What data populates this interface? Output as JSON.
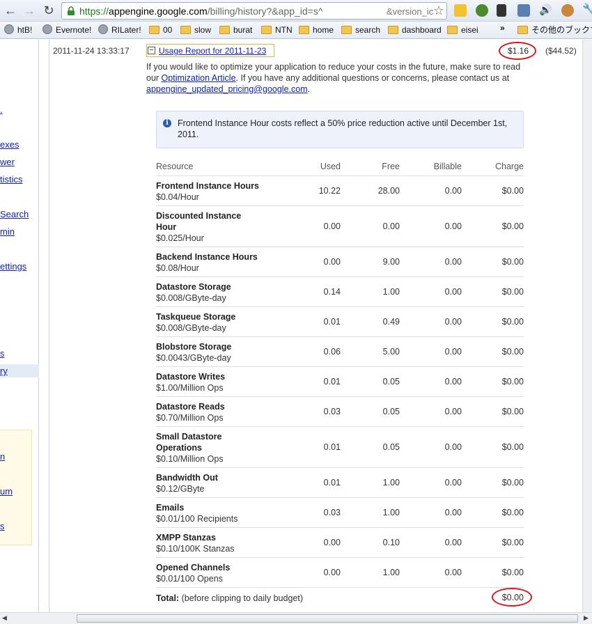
{
  "browser": {
    "url_scheme": "https://",
    "url_host": "appengine.google.com",
    "url_path": "/billing/history?&app_id=s^",
    "url_tail": "&version_ic",
    "bookmarks": [
      "htB!",
      "Evernote!",
      "RILater!",
      "00",
      "slow",
      "burat",
      "NTN",
      "home",
      "search",
      "dashboard",
      "eisei",
      "»",
      "その他のブックマーク"
    ]
  },
  "leftnav": {
    "items": [
      ".",
      "exes",
      "wer",
      "tistics",
      "Search",
      "min",
      "ettings",
      "s",
      "ry",
      "n",
      "um",
      "s"
    ]
  },
  "entry": {
    "datetime": "2011-11-24 13:33:17",
    "collapse_glyph": "−",
    "report_link": "Usage Report for 2011-11-23",
    "amount": "$1.16",
    "balance": "($44.52)",
    "advice_1": "If you would like to optimize your application to reduce your costs in the future, make sure to read our ",
    "advice_link_1": "Optimization Article",
    "advice_2": ". If you have any additional questions or concerns, please contact us at ",
    "advice_link_2": "appengine_updated_pricing@google.com",
    "advice_3": ".",
    "notice": "Frontend Instance Hour costs reflect a 50% price reduction active until December 1st, 2011."
  },
  "table": {
    "headers": {
      "resource": "Resource",
      "used": "Used",
      "free": "Free",
      "billable": "Billable",
      "charge": "Charge"
    },
    "rows": [
      {
        "name": "Frontend Instance Hours",
        "rate": "$0.04/Hour",
        "used": "10.22",
        "free": "28.00",
        "billable": "0.00",
        "charge": "$0.00"
      },
      {
        "name": "Discounted Instance Hour",
        "rate": "$0.025/Hour",
        "used": "0.00",
        "free": "0.00",
        "billable": "0.00",
        "charge": "$0.00"
      },
      {
        "name": "Backend Instance Hours",
        "rate": "$0.08/Hour",
        "used": "0.00",
        "free": "9.00",
        "billable": "0.00",
        "charge": "$0.00"
      },
      {
        "name": "Datastore Storage",
        "rate": "$0.008/GByte-day",
        "used": "0.14",
        "free": "1.00",
        "billable": "0.00",
        "charge": "$0.00"
      },
      {
        "name": "Taskqueue Storage",
        "rate": "$0.008/GByte-day",
        "used": "0.01",
        "free": "0.49",
        "billable": "0.00",
        "charge": "$0.00"
      },
      {
        "name": "Blobstore Storage",
        "rate": "$0.0043/GByte-day",
        "used": "0.06",
        "free": "5.00",
        "billable": "0.00",
        "charge": "$0.00"
      },
      {
        "name": "Datastore Writes",
        "rate": "$1.00/Million Ops",
        "used": "0.01",
        "free": "0.05",
        "billable": "0.00",
        "charge": "$0.00"
      },
      {
        "name": "Datastore Reads",
        "rate": "$0.70/Million Ops",
        "used": "0.03",
        "free": "0.05",
        "billable": "0.00",
        "charge": "$0.00"
      },
      {
        "name": "Small Datastore Operations",
        "rate": "$0.10/Million Ops",
        "used": "0.01",
        "free": "0.05",
        "billable": "0.00",
        "charge": "$0.00"
      },
      {
        "name": "Bandwidth Out",
        "rate": "$0.12/GByte",
        "used": "0.01",
        "free": "1.00",
        "billable": "0.00",
        "charge": "$0.00"
      },
      {
        "name": "Emails",
        "rate": "$0.01/100 Recipients",
        "used": "0.03",
        "free": "1.00",
        "billable": "0.00",
        "charge": "$0.00"
      },
      {
        "name": "XMPP Stanzas",
        "rate": "$0.10/100K Stanzas",
        "used": "0.00",
        "free": "0.10",
        "billable": "0.00",
        "charge": "$0.00"
      },
      {
        "name": "Opened Channels",
        "rate": "$0.01/100 Opens",
        "used": "0.00",
        "free": "1.00",
        "billable": "0.00",
        "charge": "$0.00"
      }
    ],
    "total_label": "Total:",
    "total_note": "(before clipping to daily budget)",
    "total_charge": "$0.00"
  },
  "colors": {
    "link": "#1122aa",
    "highlight_ring": "#d21b1b",
    "notice_bg": "#eef3fb"
  }
}
